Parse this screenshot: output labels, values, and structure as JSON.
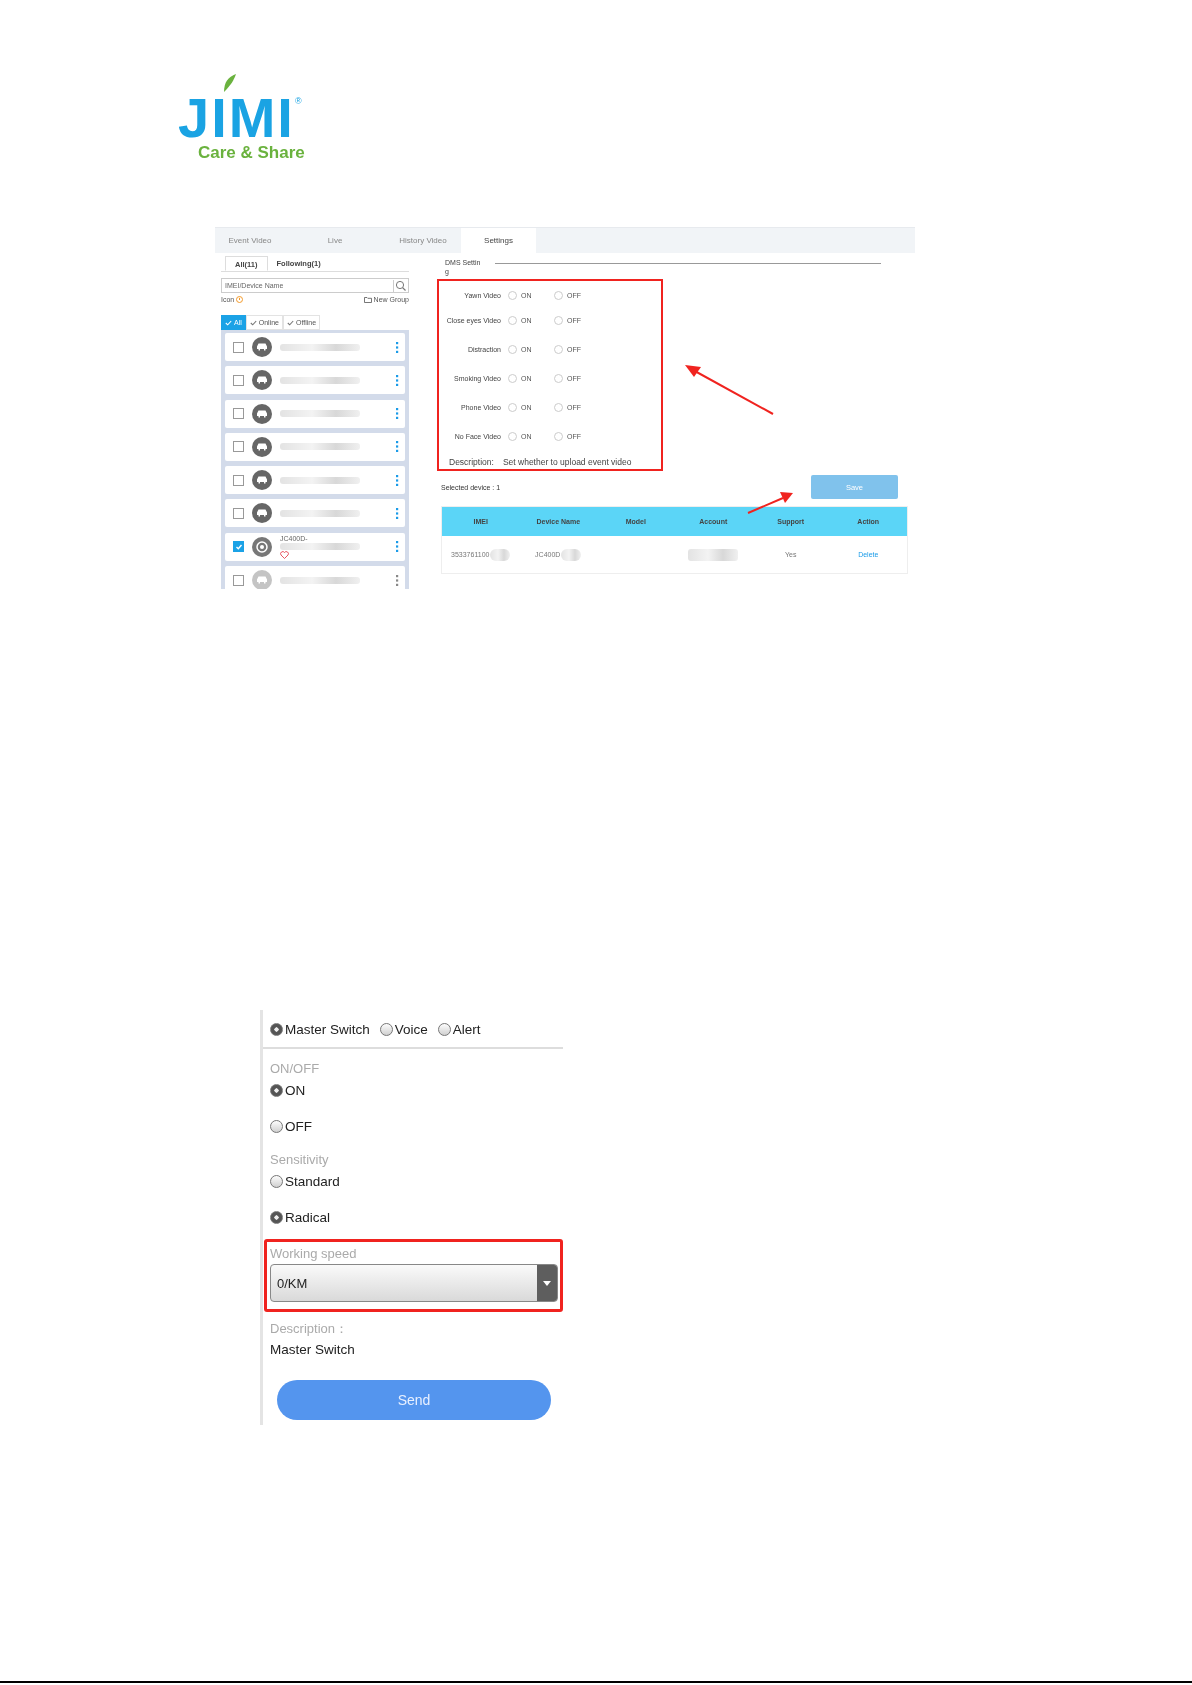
{
  "logo": {
    "wordmark": "JIMI",
    "registered": "®",
    "tagline": "Care & Share"
  },
  "dms_screen": {
    "tabs": [
      {
        "label": "Event Video",
        "selected": false
      },
      {
        "label": "Live",
        "selected": false
      },
      {
        "label": "History Video",
        "selected": false
      },
      {
        "label": "Settings",
        "selected": true
      }
    ],
    "device_panel": {
      "subtabs": [
        {
          "label": "All(11)",
          "selected": true
        },
        {
          "label": "Following(1)",
          "selected": false
        }
      ],
      "search": {
        "placeholder": "IMEI/Device Name"
      },
      "icon_label": "Icon",
      "new_group": "New Group",
      "filters": [
        {
          "label": "All",
          "selected": true
        },
        {
          "label": "Online",
          "selected": false
        },
        {
          "label": "Offline",
          "selected": false
        }
      ],
      "devices": [
        {
          "kind": "car",
          "checked": false,
          "online": true,
          "following": false
        },
        {
          "kind": "car",
          "checked": false,
          "online": true,
          "following": false
        },
        {
          "kind": "car",
          "checked": false,
          "online": true,
          "following": false
        },
        {
          "kind": "car",
          "checked": false,
          "online": true,
          "following": false
        },
        {
          "kind": "car",
          "checked": false,
          "online": true,
          "following": false
        },
        {
          "kind": "car",
          "checked": false,
          "online": true,
          "following": false
        },
        {
          "kind": "wheel",
          "name": "JC400D-",
          "checked": true,
          "online": true,
          "following": true
        },
        {
          "kind": "car",
          "checked": false,
          "online": false,
          "following": false
        }
      ]
    },
    "section_title": "DMS Setting",
    "settings": [
      {
        "label": "Yawn Video",
        "options": [
          {
            "label": "ON",
            "selected": false
          },
          {
            "label": "OFF",
            "selected": false
          }
        ]
      },
      {
        "label": "Close eyes Video",
        "options": [
          {
            "label": "ON",
            "selected": false
          },
          {
            "label": "OFF",
            "selected": false
          }
        ]
      },
      {
        "label": "Distraction",
        "options": [
          {
            "label": "ON",
            "selected": false
          },
          {
            "label": "OFF",
            "selected": false
          }
        ]
      },
      {
        "label": "Smoking Video",
        "options": [
          {
            "label": "ON",
            "selected": false
          },
          {
            "label": "OFF",
            "selected": false
          }
        ]
      },
      {
        "label": "Phone Video",
        "options": [
          {
            "label": "ON",
            "selected": false
          },
          {
            "label": "OFF",
            "selected": false
          }
        ]
      },
      {
        "label": "No Face Video",
        "options": [
          {
            "label": "ON",
            "selected": false
          },
          {
            "label": "OFF",
            "selected": false
          }
        ]
      }
    ],
    "description": {
      "label": "Description:",
      "text": "Set whether to upload event video"
    },
    "selected_count": "Selected device : 1",
    "save_button": "Save",
    "table": {
      "columns": [
        "IMEI",
        "Device Name",
        "Model",
        "Account",
        "Support",
        "Action"
      ],
      "rows": [
        {
          "imei": "3533761100",
          "device_name": "JC400D",
          "support": "Yes",
          "action": "Delete"
        }
      ]
    }
  },
  "adas_screen": {
    "modes": [
      {
        "label": "Master Switch",
        "selected": true
      },
      {
        "label": "Voice",
        "selected": false
      },
      {
        "label": "Alert",
        "selected": false
      }
    ],
    "groups": [
      {
        "title": "ON/OFF",
        "options": [
          {
            "label": "ON",
            "selected": true
          },
          {
            "label": "OFF",
            "selected": false
          }
        ]
      },
      {
        "title": "Sensitivity",
        "options": [
          {
            "label": "Standard",
            "selected": false
          },
          {
            "label": "Radical",
            "selected": true
          }
        ]
      }
    ],
    "working_speed": {
      "label": "Working speed",
      "value": "0/KM"
    },
    "description": {
      "label": "Description：",
      "text": "Master Switch"
    },
    "send_button": "Send"
  }
}
